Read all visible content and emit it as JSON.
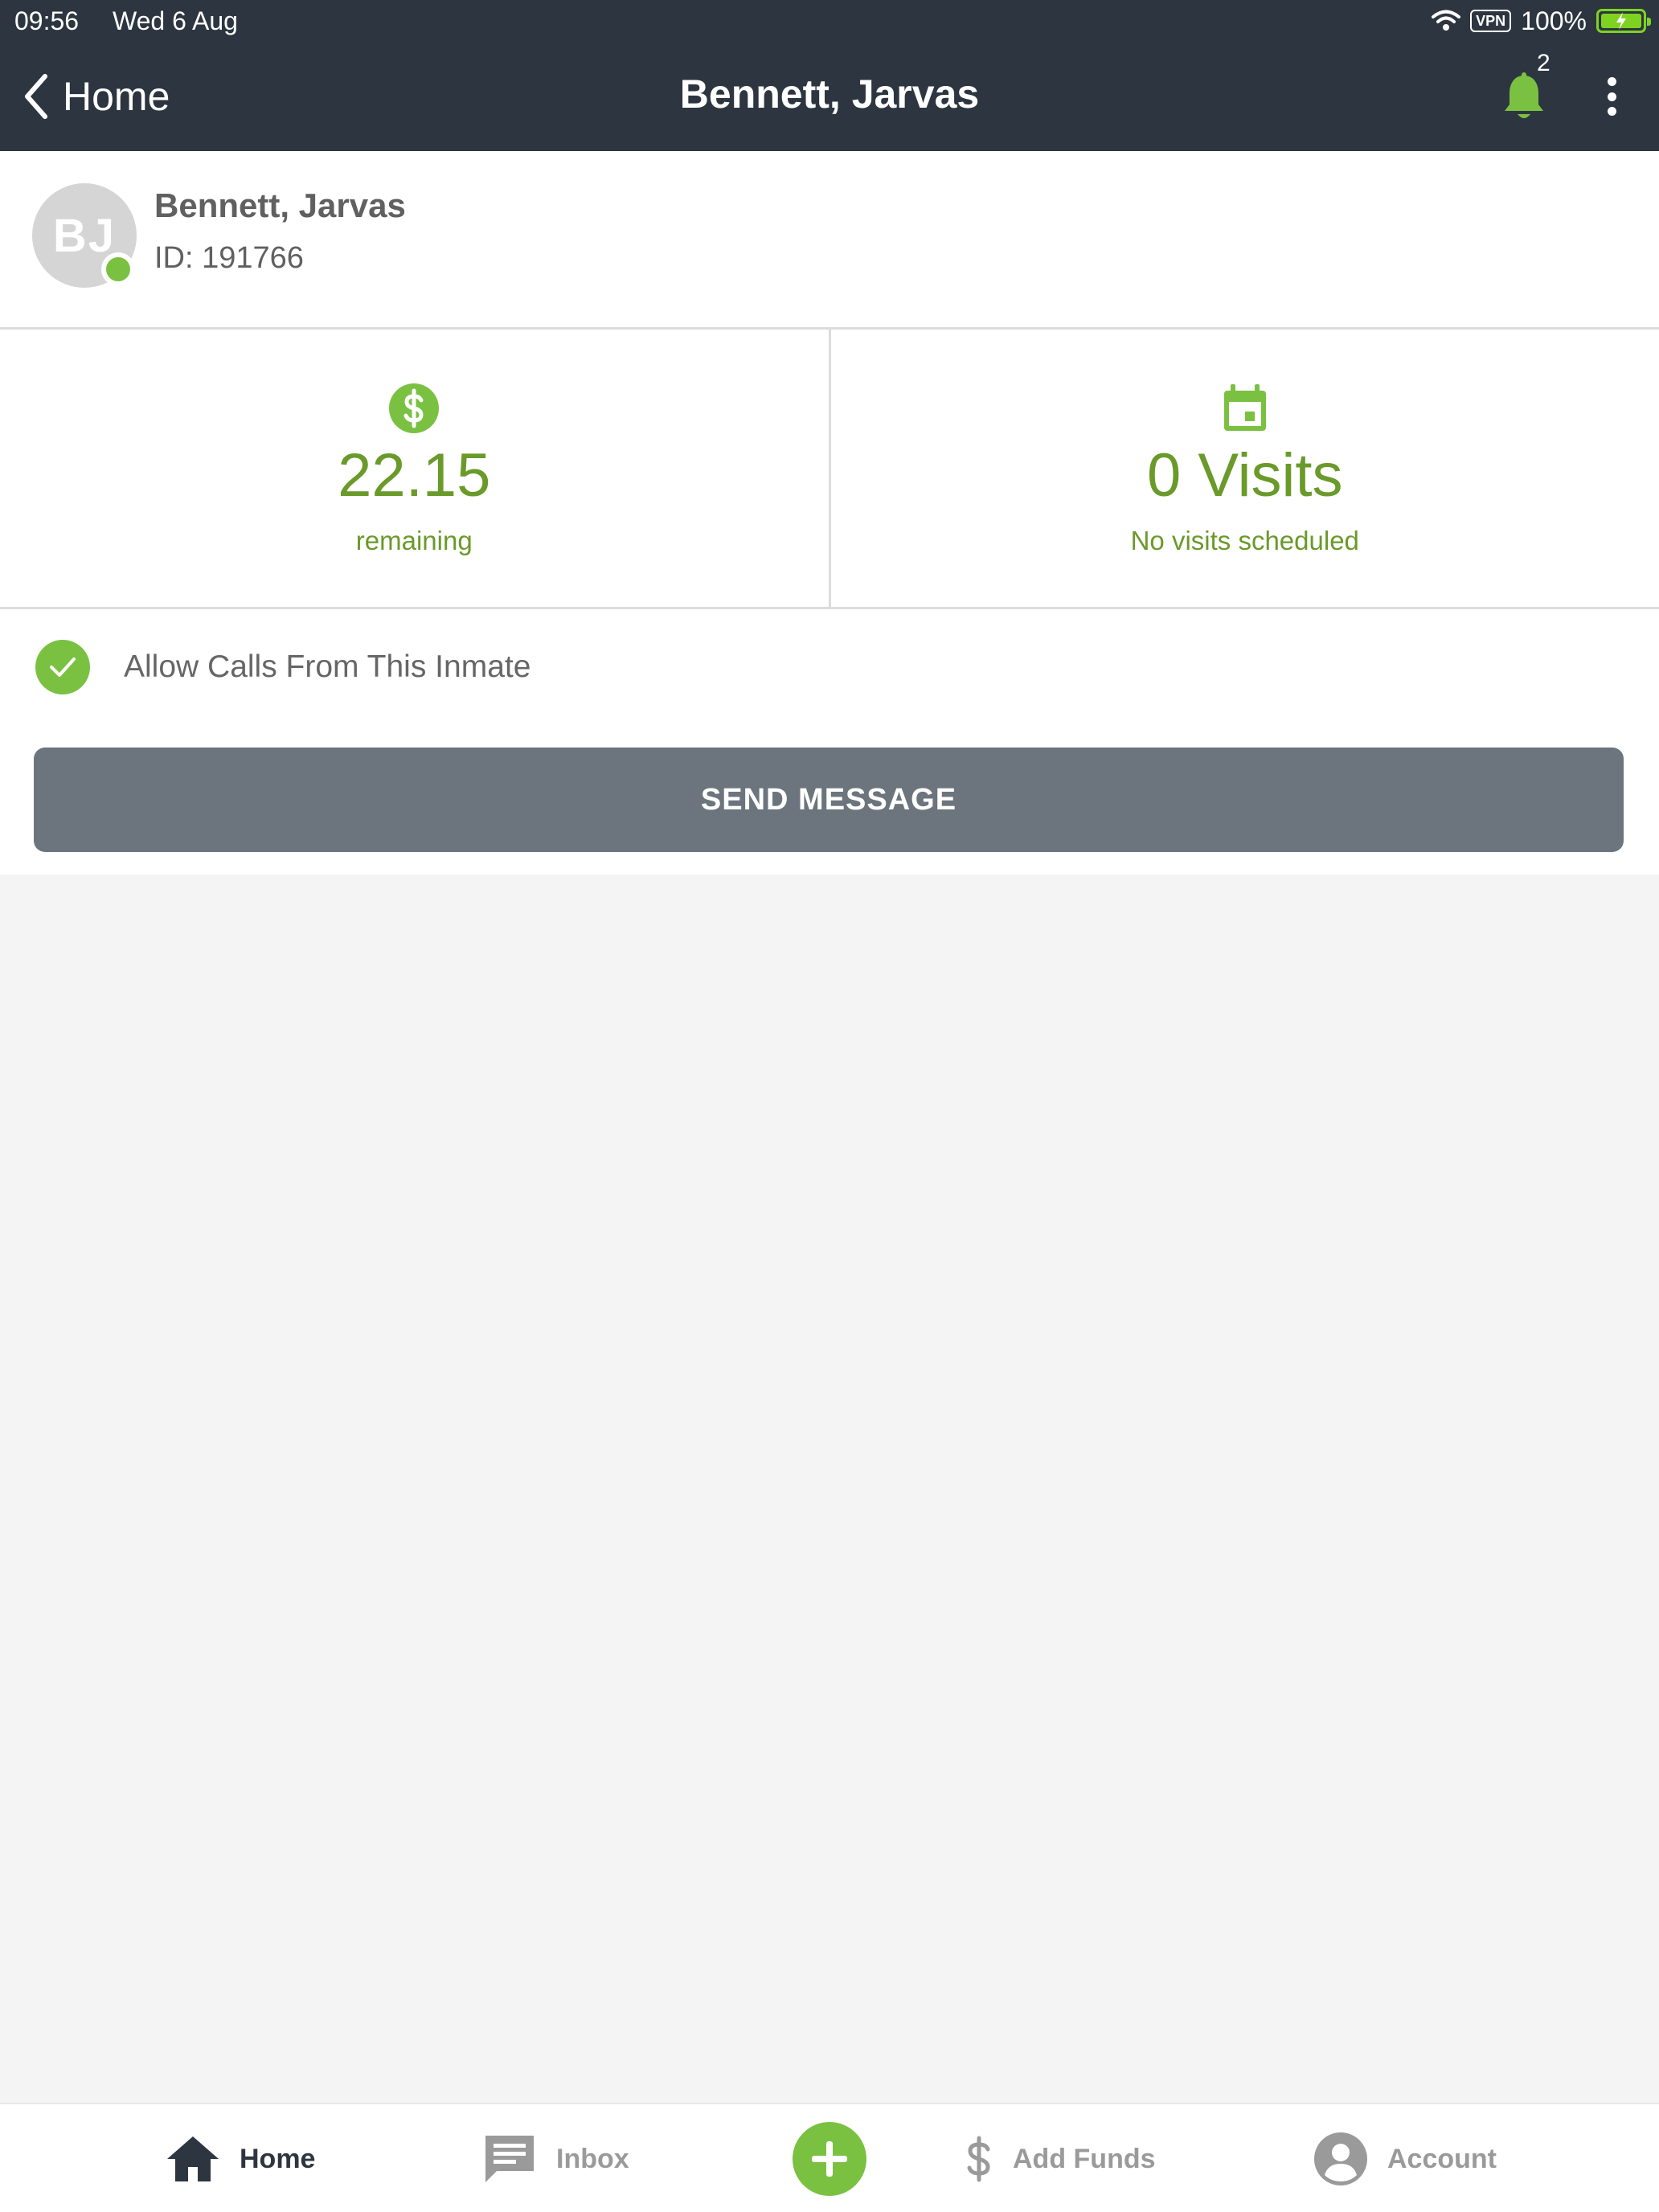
{
  "status_bar": {
    "time": "09:56",
    "date": "Wed 6 Aug",
    "vpn": "VPN",
    "battery": "100%"
  },
  "nav": {
    "back_label": "Home",
    "title": "Bennett, Jarvas",
    "notification_count": "2"
  },
  "profile": {
    "initials": "BJ",
    "name": "Bennett, Jarvas",
    "id_text": "ID: 191766",
    "online": true
  },
  "stats": {
    "balance_value": "22.15",
    "balance_sub": "remaining",
    "visits_value": "0 Visits",
    "visits_sub": "No visits scheduled"
  },
  "allow_calls": {
    "label": "Allow Calls From This Inmate",
    "checked": true
  },
  "send_message_label": "SEND MESSAGE",
  "tabbar": {
    "home": "Home",
    "inbox": "Inbox",
    "add_funds": "Add Funds",
    "account": "Account"
  },
  "colors": {
    "header_bg": "#2d3640",
    "accent_green": "#7ac142",
    "value_green": "#6a9a2a",
    "button_gray": "#6c757d"
  }
}
